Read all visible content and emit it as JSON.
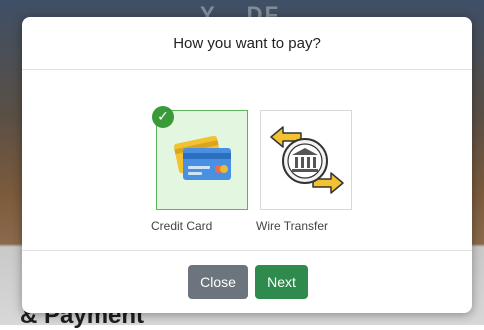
{
  "background": {
    "title_partial": "Y... DF",
    "heading_partial": "& Payment"
  },
  "modal": {
    "title": "How you want to pay?",
    "options": [
      {
        "label": "Credit Card",
        "icon": "credit-card-icon",
        "selected": true
      },
      {
        "label": "Wire Transfer",
        "icon": "bank-transfer-icon",
        "selected": false
      }
    ],
    "selected_check": "✓",
    "buttons": {
      "close_label": "Close",
      "next_label": "Next"
    }
  },
  "colors": {
    "selected_border": "#5fb35a",
    "selected_bg": "#e3f6e0",
    "check": "#3a9a3a",
    "close_button": "#6c757d",
    "next_button": "#2e8b4d",
    "arrow": "#f2c230"
  }
}
